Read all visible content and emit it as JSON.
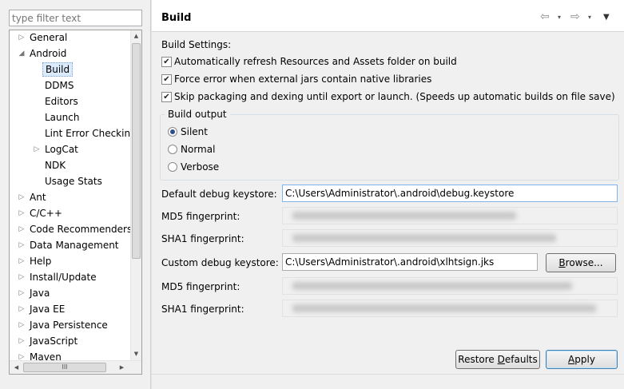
{
  "filter": {
    "placeholder": "type filter text"
  },
  "tree": {
    "items": [
      {
        "label": "General",
        "expandable": true,
        "expanded": false,
        "level": 0
      },
      {
        "label": "Android",
        "expandable": true,
        "expanded": true,
        "level": 0
      },
      {
        "label": "Build",
        "expandable": false,
        "level": 1,
        "selected": true
      },
      {
        "label": "DDMS",
        "expandable": false,
        "level": 1
      },
      {
        "label": "Editors",
        "expandable": false,
        "level": 1
      },
      {
        "label": "Launch",
        "expandable": false,
        "level": 1
      },
      {
        "label": "Lint Error Checking",
        "expandable": false,
        "level": 1
      },
      {
        "label": "LogCat",
        "expandable": true,
        "expanded": false,
        "level": 1
      },
      {
        "label": "NDK",
        "expandable": false,
        "level": 1
      },
      {
        "label": "Usage Stats",
        "expandable": false,
        "level": 1
      },
      {
        "label": "Ant",
        "expandable": true,
        "expanded": false,
        "level": 0
      },
      {
        "label": "C/C++",
        "expandable": true,
        "expanded": false,
        "level": 0
      },
      {
        "label": "Code Recommenders",
        "expandable": true,
        "expanded": false,
        "level": 0
      },
      {
        "label": "Data Management",
        "expandable": true,
        "expanded": false,
        "level": 0
      },
      {
        "label": "Help",
        "expandable": true,
        "expanded": false,
        "level": 0
      },
      {
        "label": "Install/Update",
        "expandable": true,
        "expanded": false,
        "level": 0
      },
      {
        "label": "Java",
        "expandable": true,
        "expanded": false,
        "level": 0
      },
      {
        "label": "Java EE",
        "expandable": true,
        "expanded": false,
        "level": 0
      },
      {
        "label": "Java Persistence",
        "expandable": true,
        "expanded": false,
        "level": 0
      },
      {
        "label": "JavaScript",
        "expandable": true,
        "expanded": false,
        "level": 0
      },
      {
        "label": "Maven",
        "expandable": true,
        "expanded": false,
        "level": 0
      }
    ]
  },
  "page": {
    "title": "Build",
    "build_settings_label": "Build Settings:",
    "checkboxes": [
      {
        "label": "Automatically refresh Resources and Assets folder on build",
        "checked": true
      },
      {
        "label": "Force error when external jars contain native libraries",
        "checked": true
      },
      {
        "label": "Skip packaging and dexing until export or launch. (Speeds up automatic builds on file save)",
        "checked": true
      }
    ],
    "build_output": {
      "title": "Build output",
      "options": [
        {
          "label": "Silent",
          "selected": true
        },
        {
          "label": "Normal",
          "selected": false
        },
        {
          "label": "Verbose",
          "selected": false
        }
      ]
    },
    "default_keystore_label": "Default debug keystore:",
    "default_keystore_value": "C:\\Users\\Administrator\\.android\\debug.keystore",
    "md5_label": "MD5 fingerprint:",
    "sha1_label": "SHA1 fingerprint:",
    "custom_keystore_label": "Custom debug keystore:",
    "custom_keystore_value": "C:\\Users\\Administrator\\.android\\xlhtsign.jks",
    "browse_button": {
      "pre": "",
      "mnemonic": "B",
      "post": "rowse..."
    },
    "restore_button": {
      "pre": "Restore ",
      "mnemonic": "D",
      "post": "efaults"
    },
    "apply_button": {
      "pre": "",
      "mnemonic": "A",
      "post": "pply"
    }
  },
  "icons": {
    "back": "⇦",
    "forward": "⇨",
    "dropdown": "▾",
    "view_menu": "▼",
    "tree_collapsed": "▷",
    "tree_expanded": "◢",
    "scroll_up": "▲",
    "scroll_down": "▼",
    "scroll_left": "◀",
    "scroll_right": "▶",
    "grip": "III"
  },
  "colors": {
    "selection": "#dcebfc",
    "field_focus_border": "#7eb4ea",
    "default_button_border": "#3c7fb1"
  }
}
